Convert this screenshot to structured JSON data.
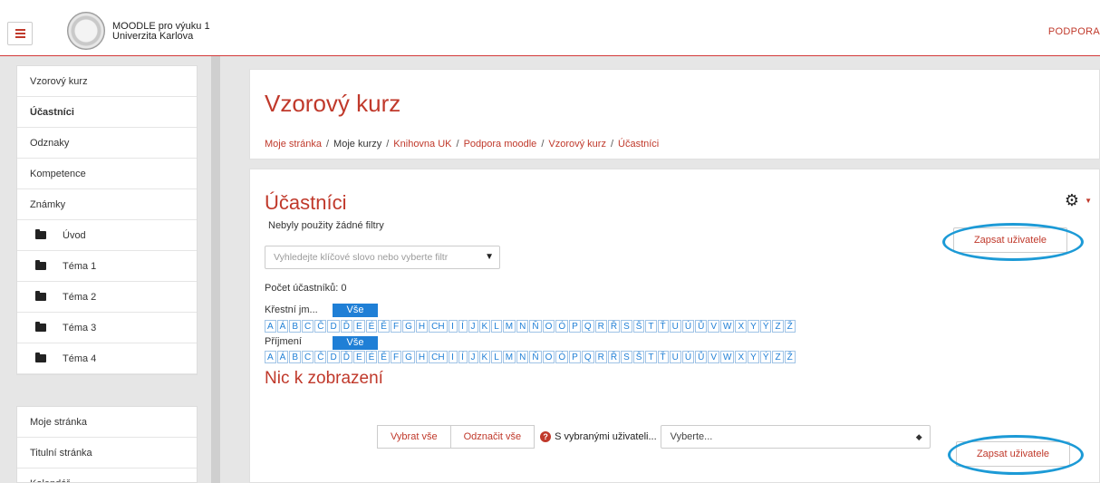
{
  "header": {
    "site_name_line1": "MOODLE pro výuku 1",
    "site_name_line2": "Univerzita Karlova",
    "right_link": "PODPORA"
  },
  "sidebar": {
    "group1": [
      {
        "label": "Vzorový kurz",
        "bold": false,
        "icon": null
      },
      {
        "label": "Účastníci",
        "bold": true,
        "icon": null
      },
      {
        "label": "Odznaky",
        "bold": false,
        "icon": null
      },
      {
        "label": "Kompetence",
        "bold": false,
        "icon": null
      },
      {
        "label": "Známky",
        "bold": false,
        "icon": null
      },
      {
        "label": "Úvod",
        "bold": false,
        "icon": "folder-icon"
      },
      {
        "label": "Téma 1",
        "bold": false,
        "icon": "folder-icon"
      },
      {
        "label": "Téma 2",
        "bold": false,
        "icon": "folder-icon"
      },
      {
        "label": "Téma 3",
        "bold": false,
        "icon": "folder-icon"
      },
      {
        "label": "Téma 4",
        "bold": false,
        "icon": "folder-icon"
      }
    ],
    "group2": [
      {
        "label": "Moje stránka"
      },
      {
        "label": "Titulní stránka"
      },
      {
        "label": "Kalendář"
      }
    ]
  },
  "course": {
    "title": "Vzorový kurz",
    "breadcrumb": [
      {
        "label": "Moje stránka",
        "link": true
      },
      {
        "label": "Moje kurzy",
        "link": false
      },
      {
        "label": "Knihovna UK",
        "link": true
      },
      {
        "label": "Podpora moodle",
        "link": true
      },
      {
        "label": "Vzorový kurz",
        "link": true
      },
      {
        "label": "Účastníci",
        "link": true
      }
    ]
  },
  "participants": {
    "title": "Účastníci",
    "no_filters": "Nebyly použity žádné filtry",
    "filter_placeholder": "Vyhledejte klíčové slovo nebo vyberte filtr",
    "count_text": "Počet účastníků: 0",
    "firstname_label": "Křestní jm...",
    "lastname_label": "Příjmení",
    "all_label": "Vše",
    "letters": [
      "A",
      "Á",
      "B",
      "C",
      "Č",
      "D",
      "Ď",
      "E",
      "É",
      "Ě",
      "F",
      "G",
      "H",
      "CH",
      "I",
      "Í",
      "J",
      "K",
      "L",
      "M",
      "N",
      "Ň",
      "O",
      "Ó",
      "P",
      "Q",
      "R",
      "Ř",
      "S",
      "Š",
      "T",
      "Ť",
      "U",
      "Ú",
      "Ů",
      "V",
      "W",
      "X",
      "Y",
      "Ý",
      "Z",
      "Ž"
    ],
    "nothing_to_display": "Nic k zobrazení",
    "enrol_button": "Zapsat uživatele",
    "select_all": "Vybrat vše",
    "deselect_all": "Odznačit vše",
    "with_selected": "S vybranými uživateli...",
    "choose_option": "Vyberte...",
    "help_glyph": "?"
  },
  "colors": {
    "brand_red": "#c0392b",
    "link_blue": "#1f7fd6",
    "highlight_ring": "#1c9ad6"
  }
}
